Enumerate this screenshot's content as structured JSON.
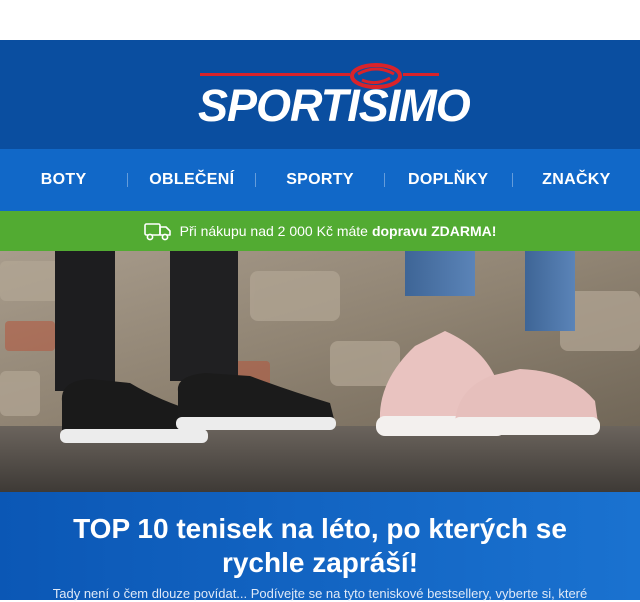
{
  "brand": {
    "name": "SPORTISIMO"
  },
  "colors": {
    "header_bg": "#0a4ea0",
    "nav_bg": "#1168c8",
    "promo_bg": "#52ab32",
    "logo_accent": "#d9232a"
  },
  "nav": {
    "items": [
      {
        "label": "BOTY"
      },
      {
        "label": "OBLEČENÍ"
      },
      {
        "label": "SPORTY"
      },
      {
        "label": "DOPLŇKY"
      },
      {
        "label": "ZNAČKY"
      }
    ]
  },
  "promo": {
    "icon": "truck-icon",
    "text": "Při nákupu nad 2 000 Kč máte",
    "highlight": "dopravu ZDARMA!"
  },
  "hero": {
    "image": "sneakers-photo"
  },
  "article": {
    "headline": "TOP 10 tenisek na léto, po kterých se rychle zapráší!",
    "intro": "Tady není o čem dlouze povídat... Podívejte se na tyto teniskové bestsellery, vyberte si, které"
  }
}
